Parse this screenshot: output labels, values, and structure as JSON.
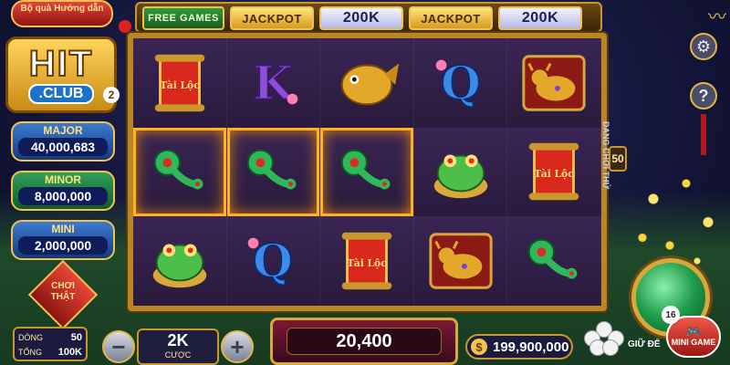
{
  "top_left": {
    "guide_button": "Bộ quà Hướng dẫn"
  },
  "logo": {
    "main": "HIT",
    "sub": ".CLUB",
    "badge": "2"
  },
  "jackpots": {
    "major": {
      "label": "MAJOR",
      "value": "40,000,683"
    },
    "minor": {
      "label": "MINOR",
      "value": "8,000,000"
    },
    "mini": {
      "label": "MINI",
      "value": "2,000,000"
    }
  },
  "real_button": {
    "label": "CHƠI THẬT"
  },
  "top_bar": {
    "free_games": "FREE GAMES",
    "jackpot_1": "JACKPOT",
    "value_1": "200K",
    "jackpot_2": "JACKPOT",
    "value_2": "200K"
  },
  "reels": [
    [
      "scroll",
      "K",
      "koi",
      "Q",
      "ox"
    ],
    [
      "jade",
      "jade",
      "jade",
      "toad",
      "scroll"
    ],
    [
      "toad",
      "Q",
      "scroll",
      "ox",
      "jade"
    ]
  ],
  "scroll_text": "Tài Lộc",
  "winning_cells": [
    [
      1,
      0
    ],
    [
      1,
      1
    ],
    [
      1,
      2
    ]
  ],
  "side": {
    "lines_label": "ĐANG CHƠI THỬ",
    "lines_value": "50"
  },
  "bottom": {
    "lines_label": "DÒNG",
    "lines_value": "50",
    "total_label": "TỔNG",
    "total_value": "100K",
    "bet_value": "2K",
    "bet_label": "CƯỢC",
    "win_value": "20,400",
    "balance_value": "199,900,000",
    "auto_label": "GIỮ ĐỂ",
    "mini_game_label": "MINI GAME",
    "mini_game_badge": "16"
  },
  "icons": {
    "settings": "gear-icon",
    "help": "question-icon",
    "minus": "minus-icon",
    "plus": "plus-icon",
    "coin": "dollar-coin-icon",
    "gamepad": "gamepad-icon"
  },
  "colors": {
    "frame_gold": "#b88624",
    "win_highlight": "#ffb21e",
    "reel_bg": "#2a1a3d"
  }
}
